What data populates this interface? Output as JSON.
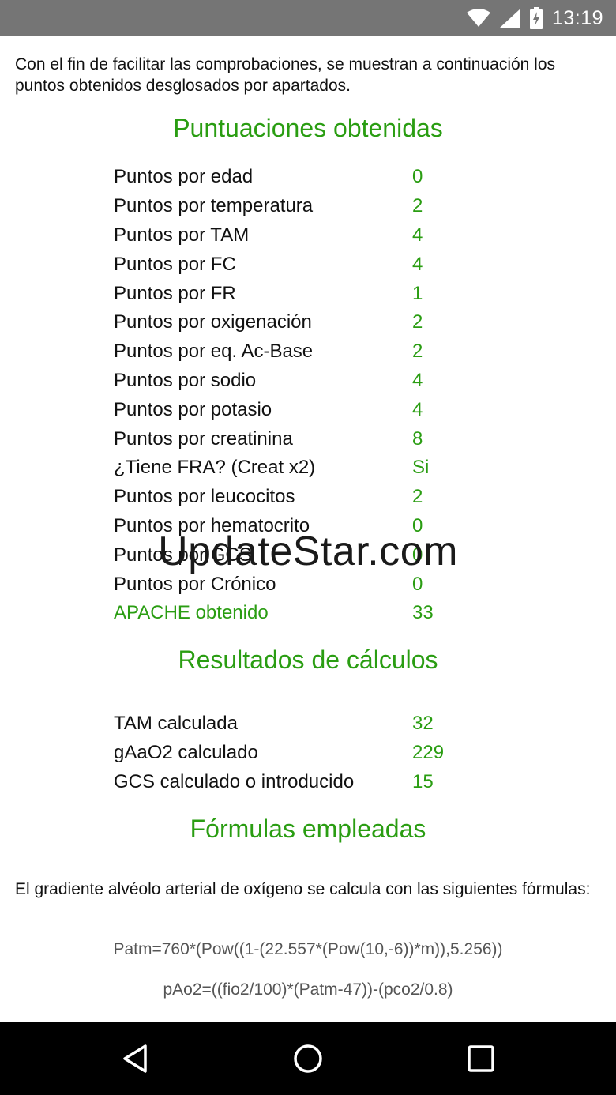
{
  "status_bar": {
    "time": "13:19",
    "icons": [
      "wifi-icon",
      "signal-icon",
      "battery-charging-icon"
    ]
  },
  "intro_text": "Con el fin de facilitar las comprobaciones, se muestran a continuación los puntos obtenidos desglosados por apartados.",
  "scores": {
    "title": "Puntuaciones obtenidas",
    "rows": [
      {
        "label": "Puntos por edad",
        "value": "0"
      },
      {
        "label": "Puntos por temperatura",
        "value": "2"
      },
      {
        "label": "Puntos por TAM",
        "value": "4"
      },
      {
        "label": "Puntos por FC",
        "value": "4"
      },
      {
        "label": "Puntos por FR",
        "value": "1"
      },
      {
        "label": "Puntos por oxigenación",
        "value": "2"
      },
      {
        "label": "Puntos por eq. Ac-Base",
        "value": "2"
      },
      {
        "label": "Puntos por sodio",
        "value": "4"
      },
      {
        "label": "Puntos por potasio",
        "value": "4"
      },
      {
        "label": "Puntos por creatinina",
        "value": "8"
      },
      {
        "label": "¿Tiene FRA? (Creat x2)",
        "value": "Si"
      },
      {
        "label": "Puntos por leucocitos",
        "value": "2"
      },
      {
        "label": "Puntos por hematocrito",
        "value": "0"
      },
      {
        "label": "Puntos por GCS",
        "value": "0"
      },
      {
        "label": "Puntos por Crónico",
        "value": "0"
      }
    ],
    "total": {
      "label": "APACHE obtenido",
      "value": "33"
    }
  },
  "results": {
    "title": "Resultados de cálculos",
    "rows": [
      {
        "label": "TAM calculada",
        "value": "32"
      },
      {
        "label": "gAaO2 calculado",
        "value": "229"
      },
      {
        "label": "GCS calculado o introducido",
        "value": "15"
      }
    ]
  },
  "formulas": {
    "title": "Fórmulas empleadas",
    "intro": "El gradiente alvéolo arterial de oxígeno se calcula con las siguientes fórmulas:",
    "lines": [
      "Patm=760*(Pow((1-(22.557*(Pow(10,-6))*m)),5.256))",
      "pAo2=((fio2/100)*(Patm-47))-(pco2/0.8)"
    ]
  },
  "watermark": "UpdateStar.com",
  "colors": {
    "accent_green": "#2a9d12",
    "status_bar": "#757575",
    "nav_bar": "#000000"
  },
  "nav_bar": {
    "icons": [
      "back-icon",
      "home-icon",
      "recents-icon"
    ]
  }
}
